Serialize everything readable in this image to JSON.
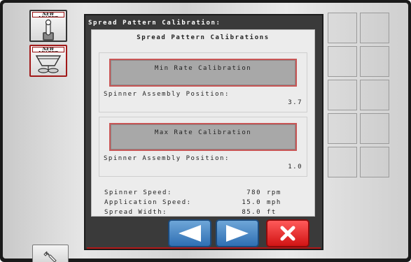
{
  "left_panel": {
    "tile_1_brand": "NEW LEADER",
    "tile_2_brand": "NEW LEADER"
  },
  "screen": {
    "title": "Spread Pattern Calibration:",
    "heading": "Spread Pattern Calibrations",
    "min_cal": {
      "button_label": "Min Rate Calibration",
      "position_label": "Spinner Assembly Position:",
      "position_value": "3.7"
    },
    "max_cal": {
      "button_label": "Max Rate Calibration",
      "position_label": "Spinner Assembly Position:",
      "position_value": "1.0"
    },
    "stats": [
      {
        "label": "Spinner Speed:",
        "value": "780",
        "unit": "rpm"
      },
      {
        "label": "Application Speed:",
        "value": "15.0",
        "unit": "mph"
      },
      {
        "label": "Spread Width:",
        "value": "85.0",
        "unit": "ft"
      }
    ]
  },
  "nav": {
    "prev_icon": "arrow-left-icon",
    "next_icon": "arrow-right-icon",
    "cancel_icon": "close-icon"
  },
  "colors": {
    "accent_red": "#d11414",
    "nav_blue": "#2f6fb3",
    "screen_bg": "#3a3a3a",
    "content_bg": "#ececec",
    "cal_button_bg": "#a8a8a8"
  }
}
